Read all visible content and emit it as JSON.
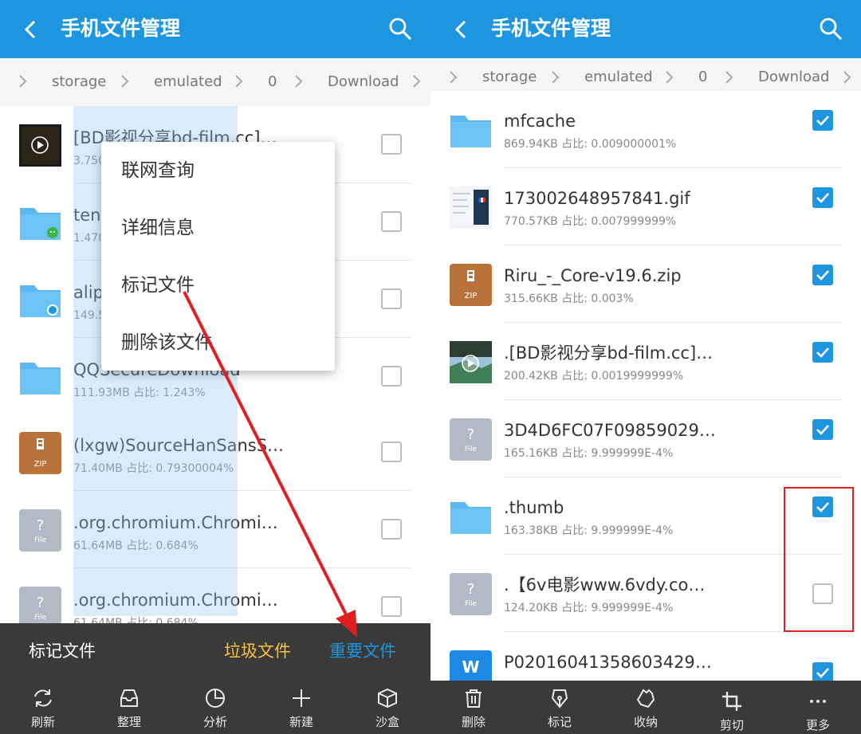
{
  "colors": {
    "primary": "#1e95df",
    "toolbar_bg": "#3a3a3a",
    "junk": "#f6c343",
    "annotation": "#e02020"
  },
  "left": {
    "title": "手机文件管理",
    "breadcrumb": [
      "storage",
      "emulated",
      "0",
      "Download"
    ],
    "files": [
      {
        "name": "[BD影视分享bd-film.cc]最...",
        "meta": "3.750",
        "icon": "video-thumbnail-icon",
        "checked": false
      },
      {
        "name": "tenc",
        "meta": "1.470",
        "icon": "folder-wechat-icon",
        "checked": false
      },
      {
        "name": "alip",
        "meta": "149.5",
        "icon": "folder-alipay-icon",
        "checked": false
      },
      {
        "name": "QQSecureDownload",
        "meta": "111.93MB  占比: 1.243%",
        "icon": "folder-icon",
        "checked": false
      },
      {
        "name": "(lxgw)SourceHanSansSC9...",
        "meta": "71.40MB  占比: 0.79300004%",
        "icon": "zip-icon",
        "checked": false
      },
      {
        "name": ".org.chromium.Chromium....",
        "meta": "61.64MB  占比: 0.684%",
        "icon": "unknown-file-icon",
        "checked": false
      },
      {
        "name": ".org.chromium.Chromium....",
        "meta": "61.64MB  占比: 0.684%",
        "icon": "unknown-file-icon",
        "checked": false
      }
    ],
    "context_menu": [
      "联网查询",
      "详细信息",
      "标记文件",
      "删除该文件"
    ],
    "mark_bar": {
      "title": "标记文件",
      "junk": "垃圾文件",
      "important": "重要文件"
    },
    "toolbar": [
      "刷新",
      "整理",
      "分析",
      "新建",
      "沙盒"
    ],
    "icon_labels": {
      "zip": "ZIP",
      "file": "File",
      "question": "?",
      "word": "W"
    }
  },
  "right": {
    "title": "手机文件管理",
    "breadcrumb": [
      "storage",
      "emulated",
      "0",
      "Download"
    ],
    "files": [
      {
        "name": "mfcache",
        "meta": "869.94KB  占比: 0.009000001%",
        "icon": "folder-icon",
        "checked": true
      },
      {
        "name": "173002648957841.gif",
        "meta": "770.57KB  占比: 0.007999999%",
        "icon": "gif-thumbnail-icon",
        "checked": true
      },
      {
        "name": "Riru_-_Core-v19.6.zip",
        "meta": "315.66KB  占比: 0.003%",
        "icon": "zip-icon",
        "checked": true
      },
      {
        "name": ".[BD影视分享bd-film.cc]最...",
        "meta": "200.42KB  占比: 0.0019999999%",
        "icon": "video-thumbnail-icon",
        "checked": true
      },
      {
        "name": "3D4D6FC07F098590295E...",
        "meta": "165.16KB  占比: 9.999999E-4%",
        "icon": "unknown-file-icon",
        "checked": true
      },
      {
        "name": ".thumb",
        "meta": "163.38KB  占比: 9.999999E-4%",
        "icon": "folder-icon",
        "checked": true
      },
      {
        "name": ".【6v电影www.6vdy.com...",
        "meta": "124.20KB  占比: 9.999999E-4%",
        "icon": "unknown-file-icon",
        "checked": false
      },
      {
        "name": "P0201604135860342987...",
        "meta": "",
        "icon": "word-file-icon",
        "checked": true
      }
    ],
    "toolbar": [
      "删除",
      "标记",
      "收纳",
      "剪切",
      "更多"
    ]
  }
}
